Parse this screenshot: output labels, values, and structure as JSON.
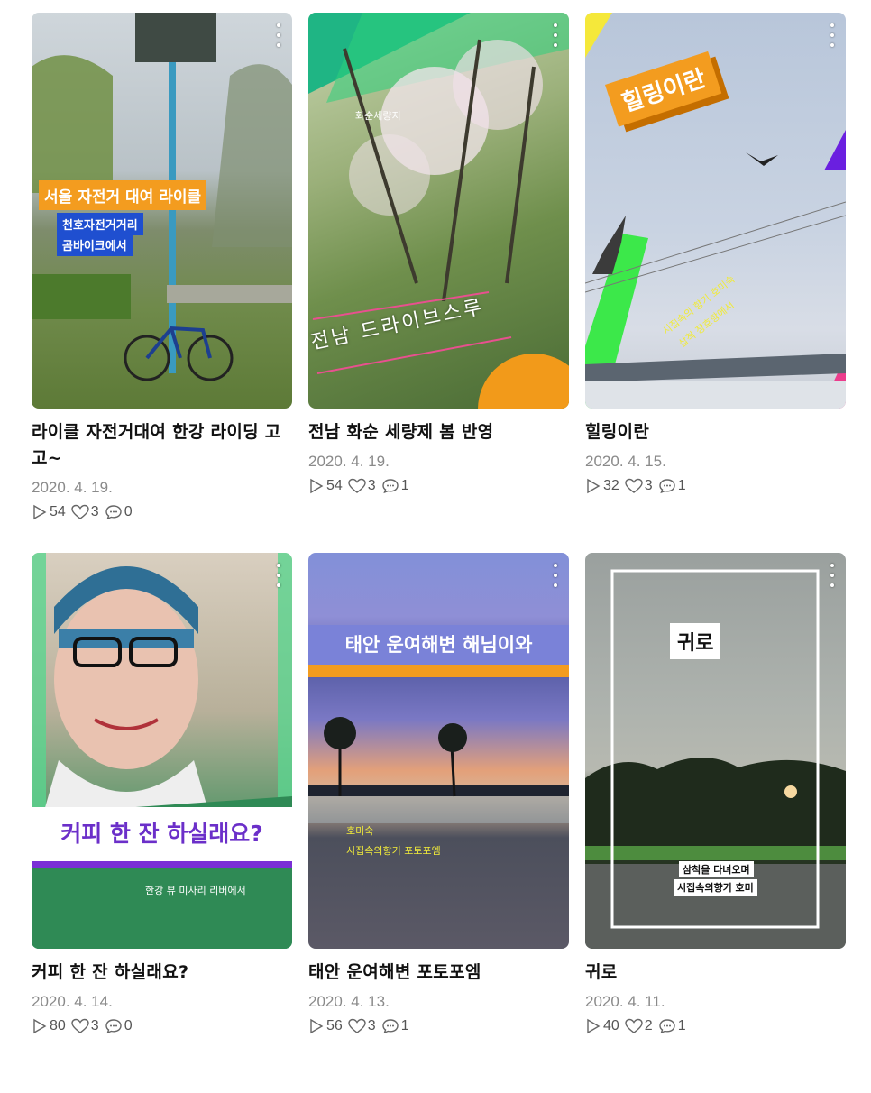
{
  "posts": [
    {
      "title": "라이클 자전거대여 한강 라이딩 고고~",
      "date": "2020. 4. 19.",
      "plays": "54",
      "likes": "3",
      "comments": "0",
      "overlay": {
        "headline": "서울 자전거 대여 라이클",
        "sub1": "천호자전거거리",
        "sub2": "곰바이크에서"
      }
    },
    {
      "title": "전남 화순 세량제 봄 반영",
      "date": "2020. 4. 19.",
      "plays": "54",
      "likes": "3",
      "comments": "1",
      "overlay": {
        "small": "화순세량지",
        "headline": "전남 드라이브스루"
      }
    },
    {
      "title": "힐링이란",
      "date": "2020. 4. 15.",
      "plays": "32",
      "likes": "3",
      "comments": "1",
      "overlay": {
        "headline": "힐링이란",
        "sub1": "시집속의 향기 호미숙",
        "sub2": "삽척 장호항에서"
      }
    },
    {
      "title": "커피 한 잔 하실래요?",
      "date": "2020. 4. 14.",
      "plays": "80",
      "likes": "3",
      "comments": "0",
      "overlay": {
        "headline": "커피 한 잔 하실래요?",
        "sub1": "한강 뷰 미사리 리버에서"
      }
    },
    {
      "title": "태안 운여해변 포토포엠",
      "date": "2020. 4. 13.",
      "plays": "56",
      "likes": "3",
      "comments": "1",
      "overlay": {
        "headline": "태안 운여해변 해님이와",
        "sub1": "호미숙",
        "sub2": "시집속의향기 포토포엠"
      }
    },
    {
      "title": "귀로",
      "date": "2020. 4. 11.",
      "plays": "40",
      "likes": "2",
      "comments": "1",
      "overlay": {
        "headline": "귀로",
        "sub1": "삼척을 다녀오며",
        "sub2": "시집속의향기 호미"
      }
    }
  ],
  "icons": {
    "play": "play-icon",
    "like": "heart-icon",
    "comment": "comment-icon",
    "menu": "more-vertical-icon"
  },
  "colors": {
    "title": "#111111",
    "meta": "#8a8a8a",
    "accent_orange": "#f39c1f",
    "accent_green": "#31e04a",
    "accent_purple": "#7a2fd6"
  }
}
